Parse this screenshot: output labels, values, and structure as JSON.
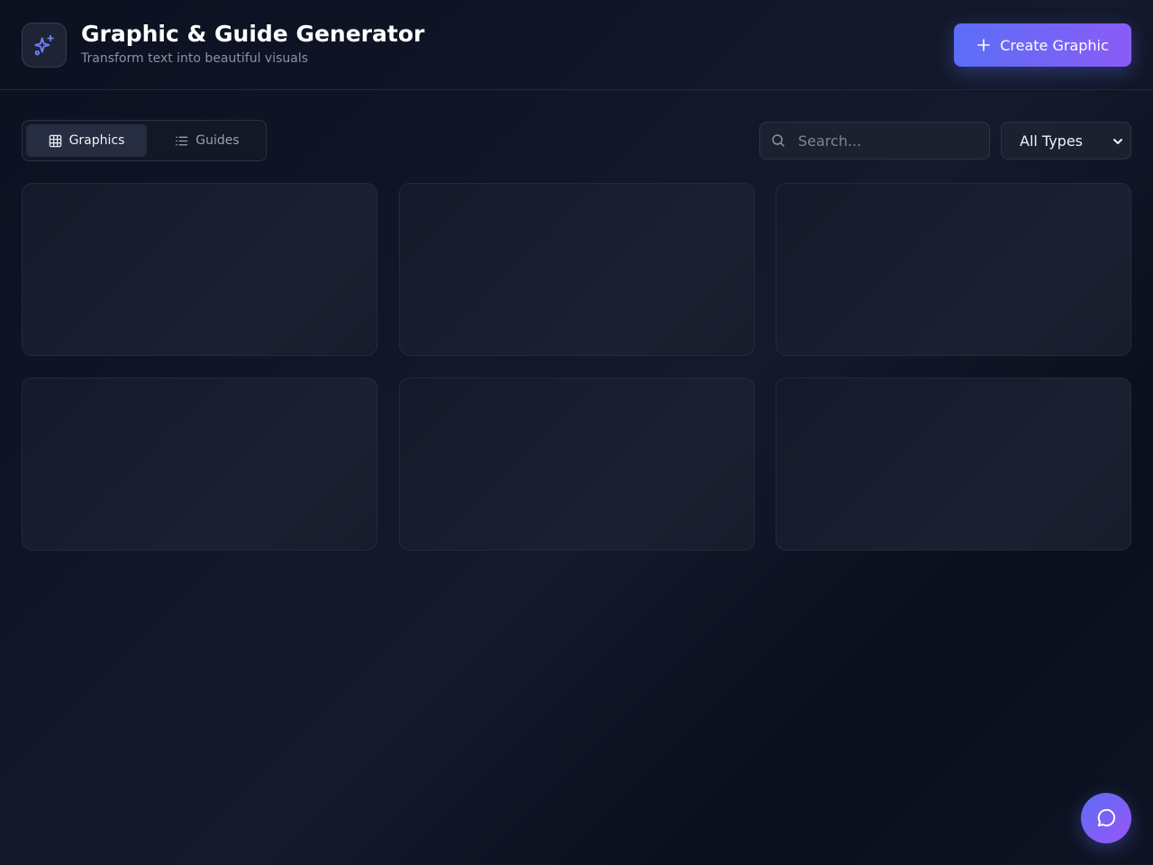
{
  "header": {
    "title": "Graphic & Guide Generator",
    "subtitle": "Transform text into beautiful visuals",
    "logo_icon": "sparkles-icon",
    "create_button": {
      "label": "Create Graphic",
      "icon": "plus-icon"
    }
  },
  "toolbar": {
    "tabs": [
      {
        "label": "Graphics",
        "icon": "grid-icon",
        "active": true
      },
      {
        "label": "Guides",
        "icon": "list-icon",
        "active": false
      }
    ],
    "search": {
      "placeholder": "Search...",
      "value": "",
      "icon": "search-icon"
    },
    "type_filter": {
      "selected": "All Types",
      "icon": "chevron-down-icon"
    }
  },
  "cards": {
    "state": "loading-placeholder",
    "count": 6
  },
  "chat_button": {
    "icon": "chat-bubble-icon"
  },
  "colors": {
    "accent_start": "#5b6ef7",
    "accent_end": "#8a5cf6",
    "background": "#0c1120",
    "surface": "#1c2130"
  }
}
